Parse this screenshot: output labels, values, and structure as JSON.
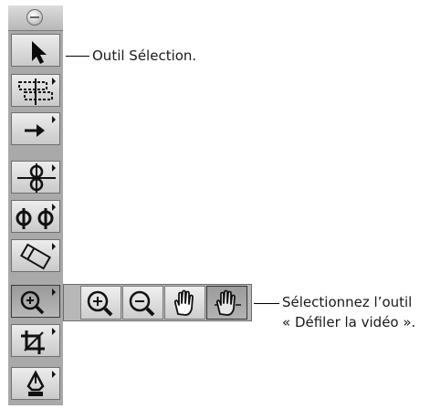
{
  "callouts": {
    "selection_tool": "Outil Sélection.",
    "scrub_line1": "Sélectionnez l’outil",
    "scrub_line2": "« Défiler la vidéo »."
  },
  "palette": {
    "tools": [
      {
        "icon": "arrow-pointer-icon",
        "has_flyout": false
      },
      {
        "icon": "edit-select-icon",
        "has_flyout": true
      },
      {
        "icon": "track-select-icon",
        "has_flyout": true
      },
      {
        "icon": "blade-icon",
        "has_flyout": true
      },
      {
        "icon": "slip-icon",
        "has_flyout": true
      },
      {
        "icon": "pen-tool-icon",
        "has_flyout": true
      },
      {
        "icon": "zoom-in-icon",
        "has_flyout": true,
        "active": true
      },
      {
        "icon": "crop-icon",
        "has_flyout": true
      },
      {
        "icon": "pen-icon",
        "has_flyout": true
      }
    ]
  },
  "flyout": {
    "items": [
      {
        "icon": "zoom-in-icon"
      },
      {
        "icon": "zoom-out-icon"
      },
      {
        "icon": "hand-icon"
      },
      {
        "icon": "scrub-video-icon",
        "selected": true
      }
    ]
  }
}
